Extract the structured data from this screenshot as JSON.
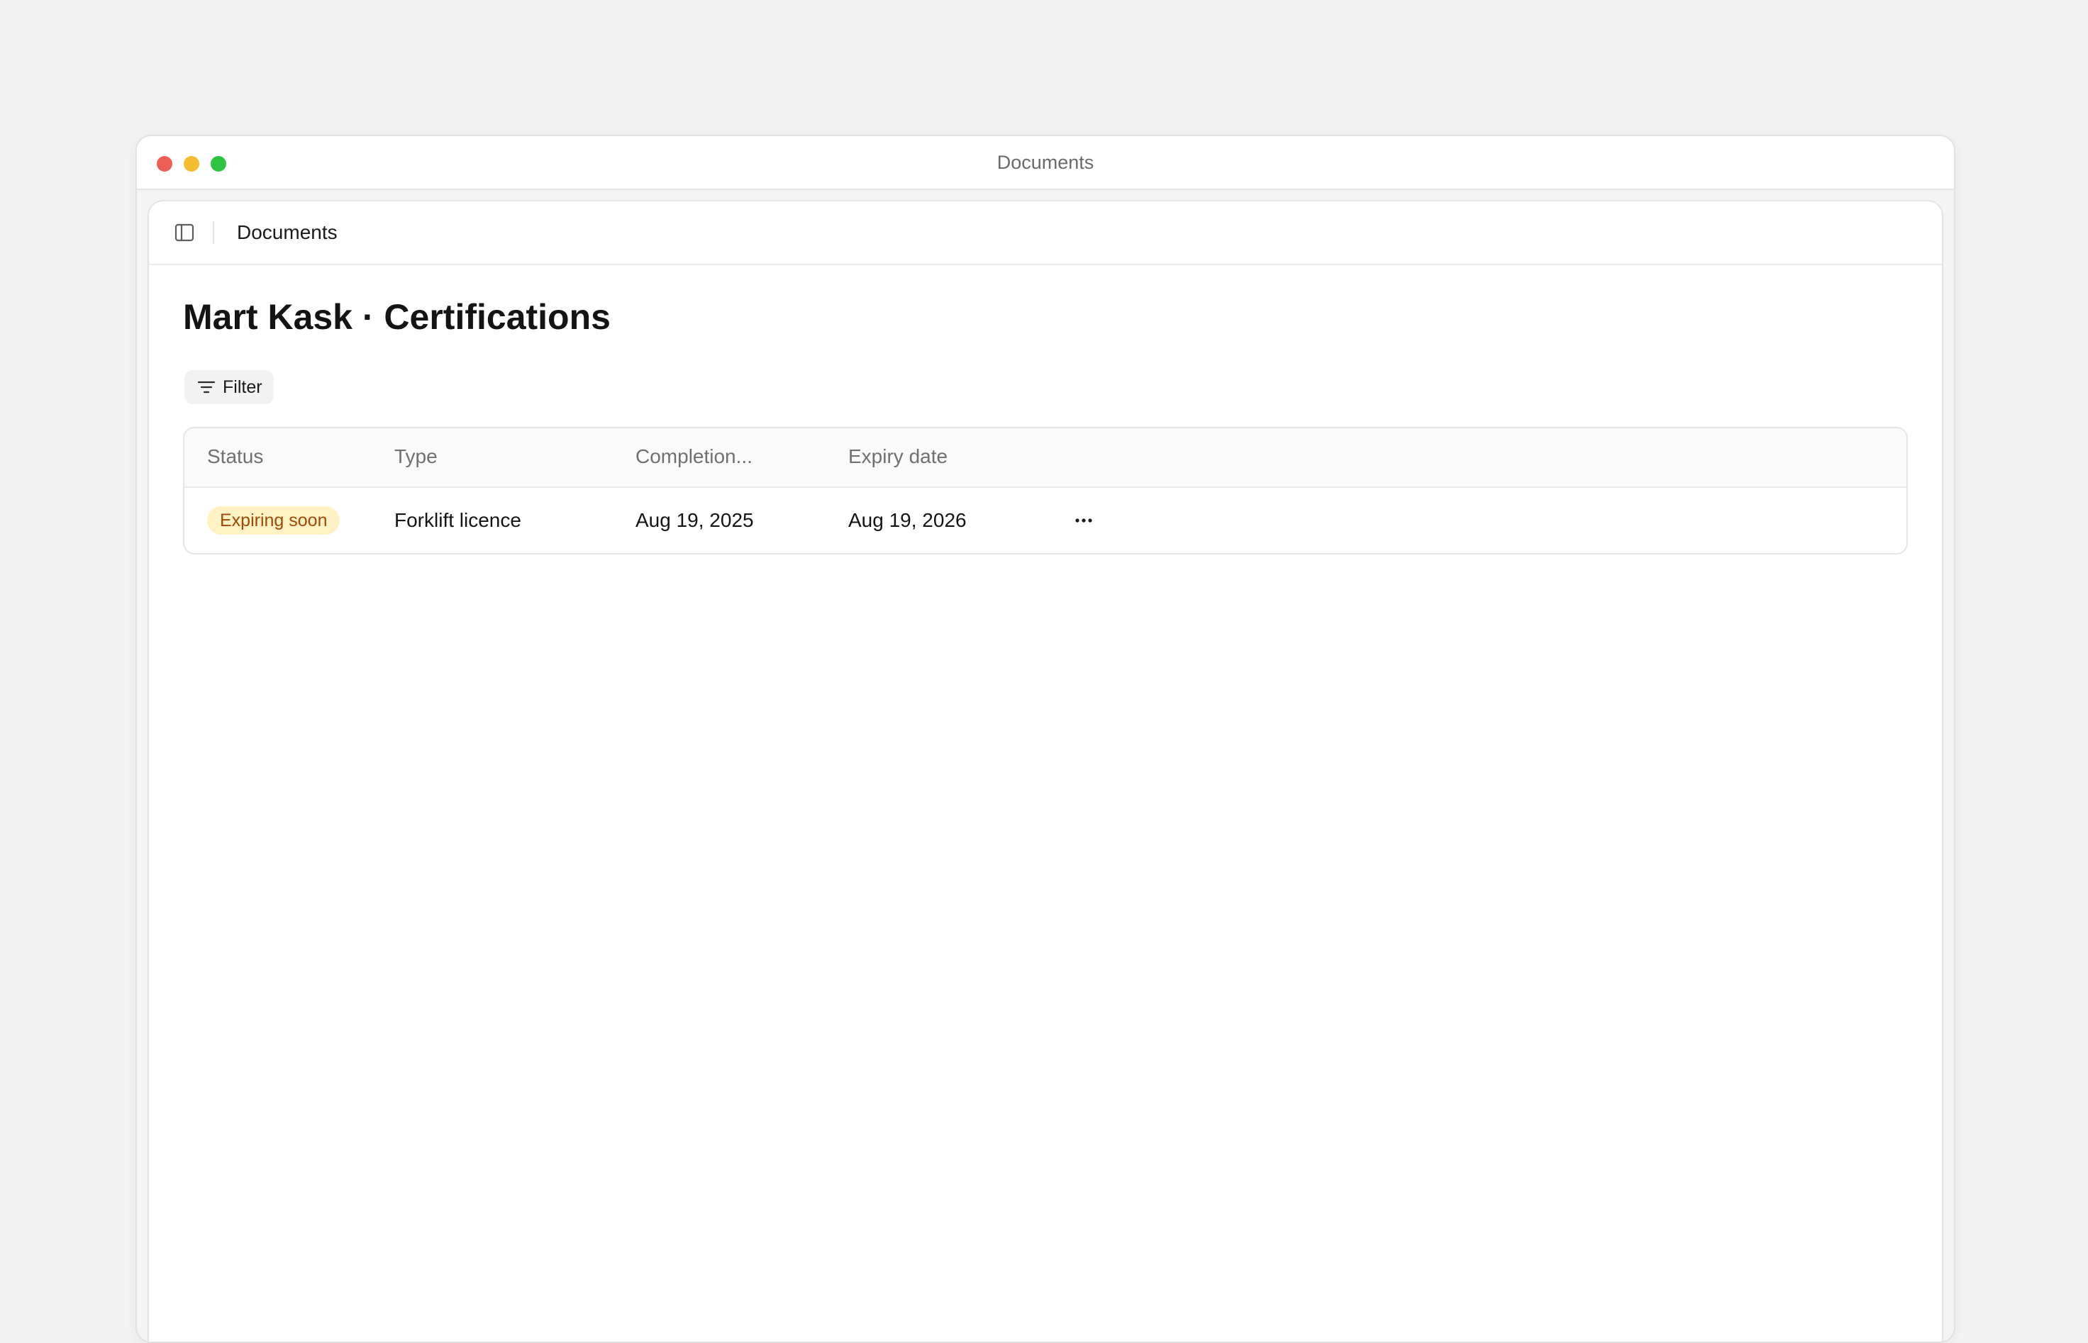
{
  "window": {
    "title": "Documents"
  },
  "header": {
    "breadcrumb": "Documents"
  },
  "page": {
    "title": "Mart Kask · Certifications"
  },
  "toolbar": {
    "filter_label": "Filter"
  },
  "table": {
    "columns": [
      "Status",
      "Type",
      "Completion...",
      "Expiry date"
    ],
    "rows": [
      {
        "status": "Expiring soon",
        "type": "Forklift licence",
        "completion": "Aug 19, 2025",
        "expiry": "Aug 19, 2026"
      }
    ]
  },
  "colors": {
    "badge_background": "#fef1c4",
    "badge_text": "#a14a06",
    "traffic_red": "#ec5f57",
    "traffic_yellow": "#f5bd2f",
    "traffic_green": "#2dc341"
  },
  "icons": {
    "sidebar_toggle": "sidebar-panel-icon",
    "filter": "filter-lines-icon",
    "more": "ellipsis-horizontal-icon"
  }
}
